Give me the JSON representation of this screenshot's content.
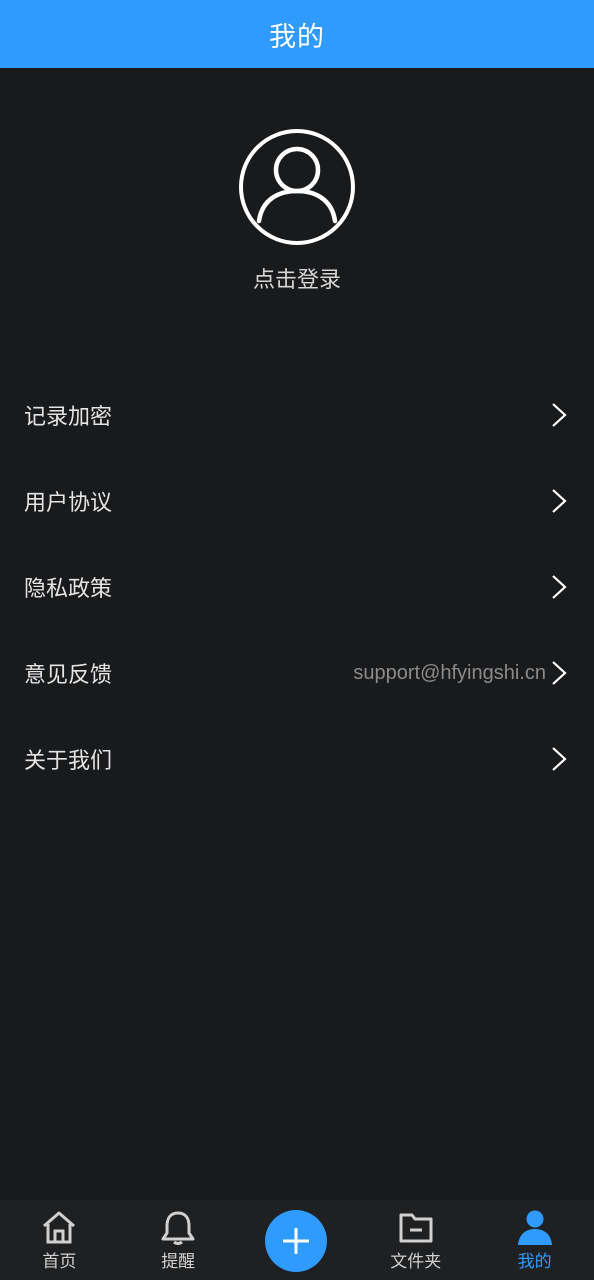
{
  "header": {
    "title": "我的"
  },
  "profile": {
    "login_text": "点击登录",
    "avatar_icon": "user-outline-icon"
  },
  "menu": {
    "items": [
      {
        "label": "记录加密",
        "value": ""
      },
      {
        "label": "用户协议",
        "value": ""
      },
      {
        "label": "隐私政策",
        "value": ""
      },
      {
        "label": "意见反馈",
        "value": "support@hfyingshi.cn"
      },
      {
        "label": "关于我们",
        "value": ""
      }
    ]
  },
  "tabbar": {
    "tabs": [
      {
        "label": "首页",
        "icon": "home-icon"
      },
      {
        "label": "提醒",
        "icon": "bell-icon"
      },
      {
        "label": "文件夹",
        "icon": "folder-icon"
      },
      {
        "label": "我的",
        "icon": "user-icon",
        "active": true
      }
    ],
    "add_icon": "plus-icon"
  },
  "colors": {
    "accent": "#2f9bff",
    "background": "#191a1c"
  }
}
